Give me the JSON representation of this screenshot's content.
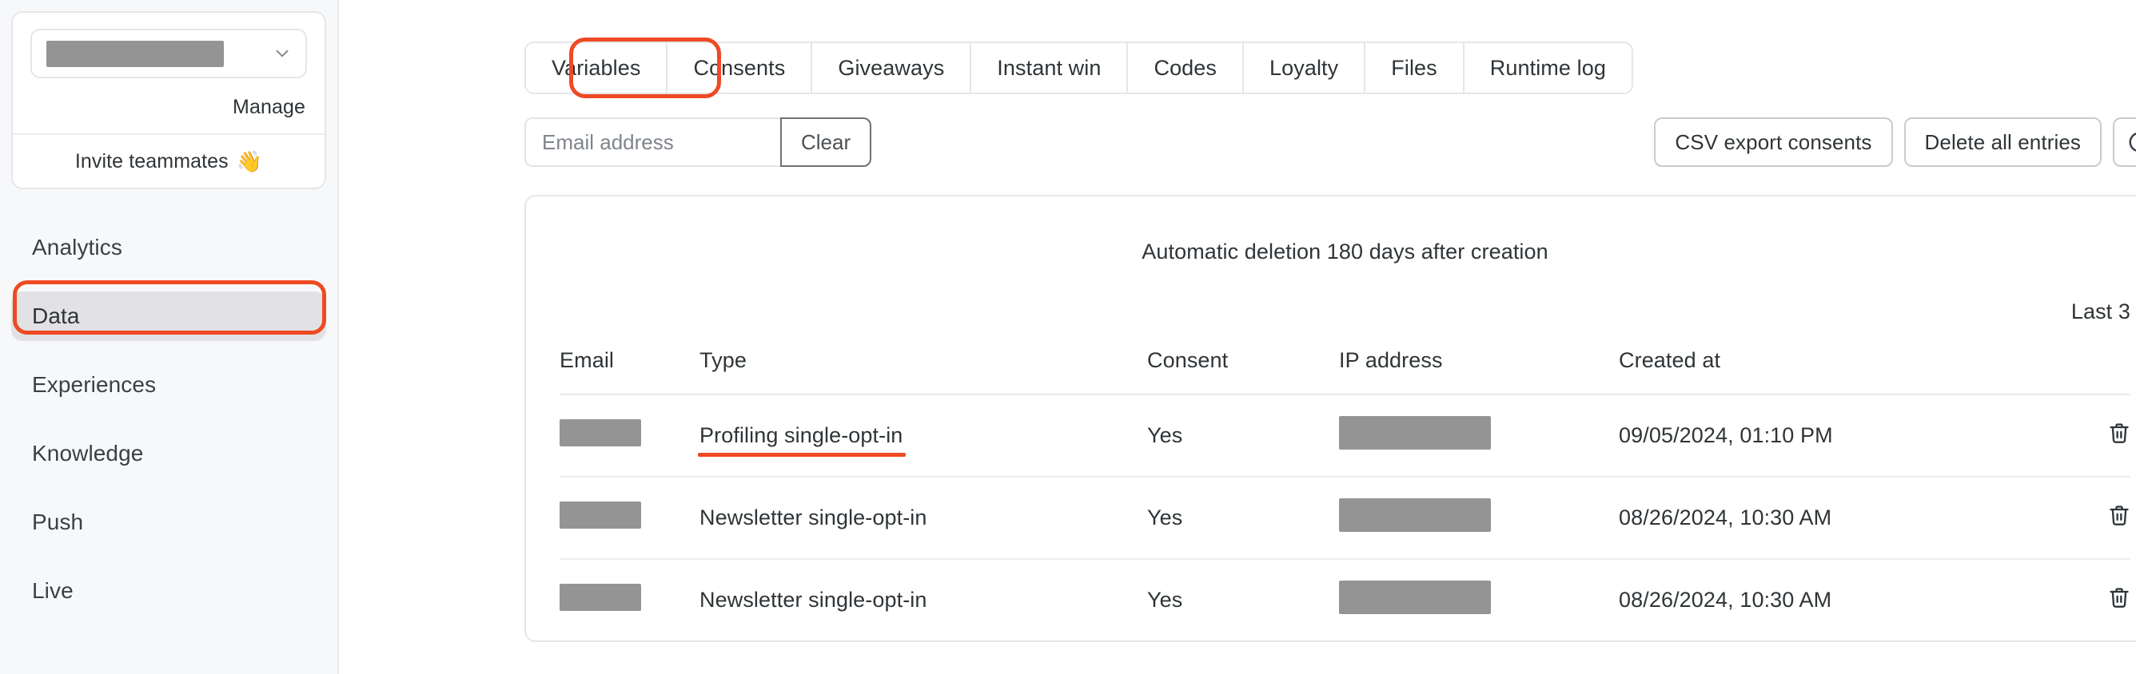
{
  "sidebar": {
    "workspace": {
      "selected_value_redacted": true,
      "manage_label": "Manage",
      "invite_label": "Invite teammates",
      "invite_emoji": "👋"
    },
    "nav_items": [
      {
        "label": "Analytics",
        "active": false
      },
      {
        "label": "Data",
        "active": true
      },
      {
        "label": "Experiences",
        "active": false
      },
      {
        "label": "Knowledge",
        "active": false
      },
      {
        "label": "Push",
        "active": false
      },
      {
        "label": "Live",
        "active": false
      }
    ]
  },
  "tabs": [
    {
      "label": "Variables",
      "selected": false
    },
    {
      "label": "Consents",
      "selected": true
    },
    {
      "label": "Giveaways",
      "selected": false
    },
    {
      "label": "Instant win",
      "selected": false
    },
    {
      "label": "Codes",
      "selected": false
    },
    {
      "label": "Loyalty",
      "selected": false
    },
    {
      "label": "Files",
      "selected": false
    },
    {
      "label": "Runtime log",
      "selected": false
    }
  ],
  "toolbar": {
    "email_filter_value": "",
    "email_filter_placeholder": "Email address",
    "clear_label": "Clear",
    "csv_export_label": "CSV export consents",
    "delete_all_label": "Delete all entries",
    "refresh_icon": "refresh-icon"
  },
  "content": {
    "deletion_note": "Automatic deletion 180 days after creation",
    "last_count_label": "Last 3",
    "columns": [
      "Email",
      "Type",
      "Consent",
      "IP address",
      "Created at"
    ],
    "rows": [
      {
        "email_redacted": true,
        "type": "Profiling single-opt-in",
        "consent": "Yes",
        "ip_redacted": true,
        "created_at": "09/05/2024, 01:10 PM",
        "annotated": true,
        "delete_icon": "trash-icon"
      },
      {
        "email_redacted": true,
        "type": "Newsletter single-opt-in",
        "consent": "Yes",
        "ip_redacted": true,
        "created_at": "08/26/2024, 10:30 AM",
        "annotated": false,
        "delete_icon": "trash-icon"
      },
      {
        "email_redacted": true,
        "type": "Newsletter single-opt-in",
        "consent": "Yes",
        "ip_redacted": true,
        "created_at": "08/26/2024, 10:30 AM",
        "annotated": false,
        "delete_icon": "trash-icon"
      }
    ]
  },
  "annotations": {
    "color": "#ef4a23",
    "highlighted_nav_item": "Data",
    "highlighted_tab": "Consents",
    "underlined_cell": "Profiling single-opt-in"
  }
}
